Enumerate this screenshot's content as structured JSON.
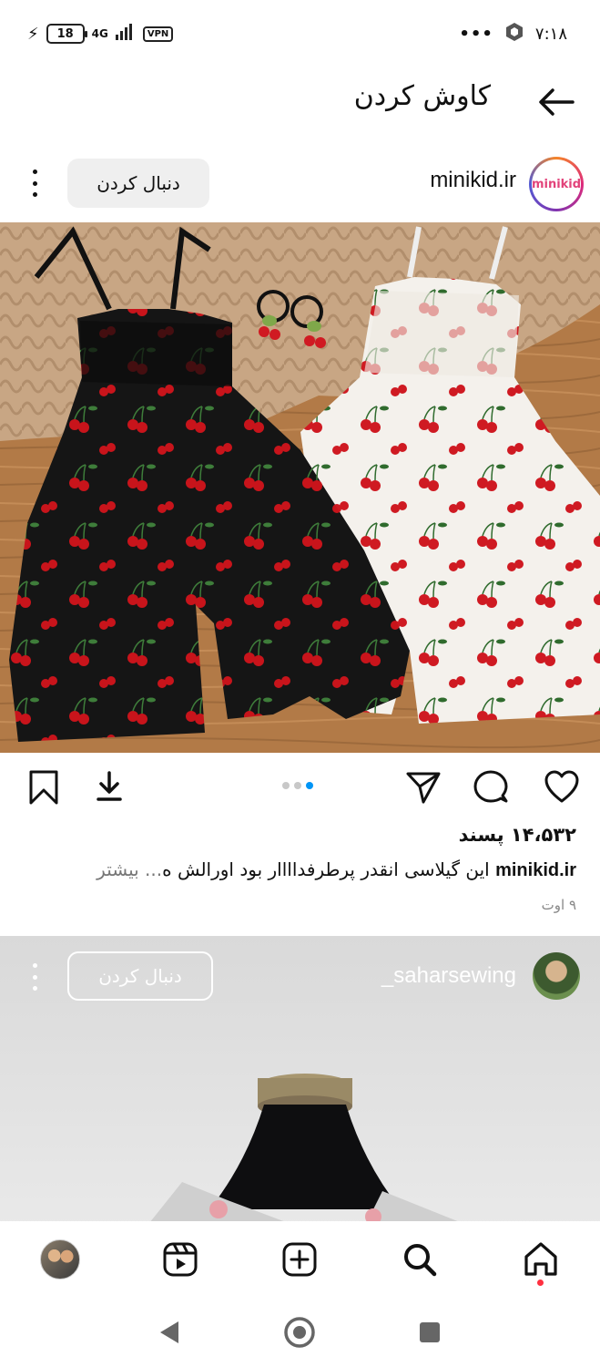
{
  "status_bar": {
    "battery": "18",
    "network": "4G",
    "vpn": "VPN",
    "overflow": "•••",
    "time": "۷:۱۸"
  },
  "header": {
    "title": "کاوش کردن"
  },
  "post1": {
    "username": "minikid.ir",
    "avatar_text": "minikid",
    "follow_label": "دنبال کردن",
    "likes": "۱۴،۵۳۲ پسند",
    "caption_user": "minikid.ir",
    "caption_text": " این گیلاسی انقدر پرطرفداااار بود  اورالش ه",
    "caption_more": "... بیشتر",
    "date": "۹ اوت",
    "carousel": {
      "count": 3,
      "active": 3
    }
  },
  "post2": {
    "username": "_saharsewing",
    "follow_label": "دنبال کردن"
  },
  "icons": {
    "back": "arrow-left-icon",
    "like": "heart-icon",
    "comment": "comment-icon",
    "share": "send-icon",
    "download": "download-icon",
    "save": "bookmark-icon"
  },
  "colors": {
    "accent": "#0095f6",
    "notification": "#ff3040",
    "follow_bg": "#efefef"
  }
}
